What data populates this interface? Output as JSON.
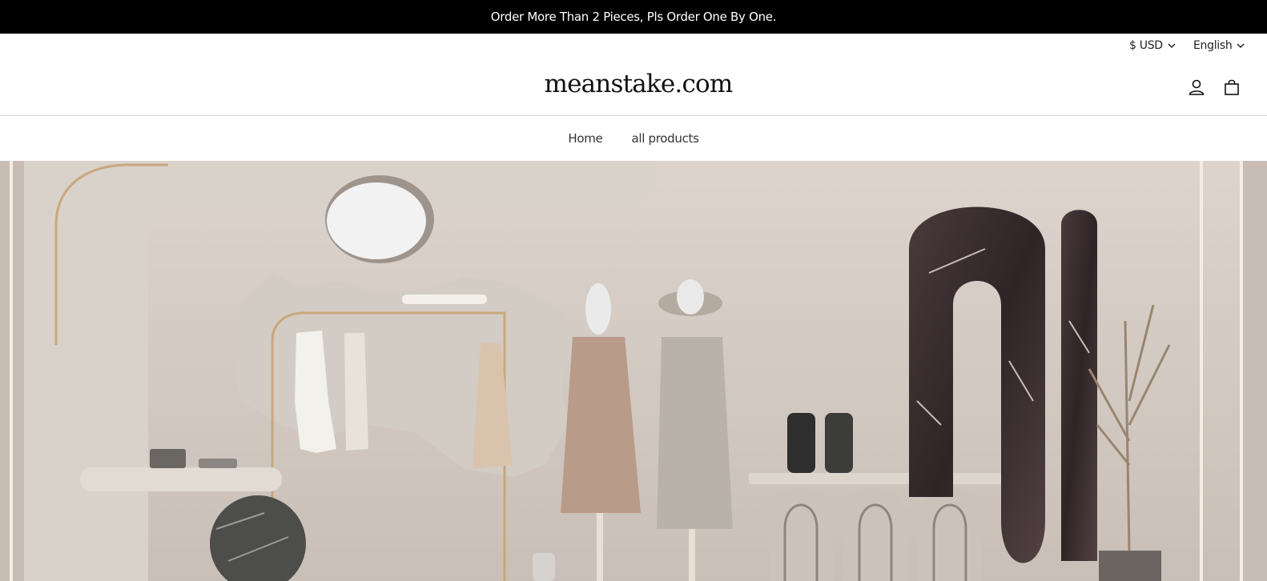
{
  "announcement": {
    "text": "Order More Than 2 Pieces, Pls Order One By One."
  },
  "header": {
    "currency": "$ USD",
    "language": "English",
    "logo": "meanstake.com",
    "icons": {
      "account": "account-icon",
      "cart": "cart-icon"
    }
  },
  "nav": {
    "items": [
      {
        "label": "Home"
      },
      {
        "label": "all products"
      }
    ]
  },
  "hero": {
    "image": "hero-banner-image",
    "colors": {
      "wall": "#d6cdc5",
      "marble_dark": "#3d2f31",
      "accent_gold": "#c9a77c"
    }
  }
}
